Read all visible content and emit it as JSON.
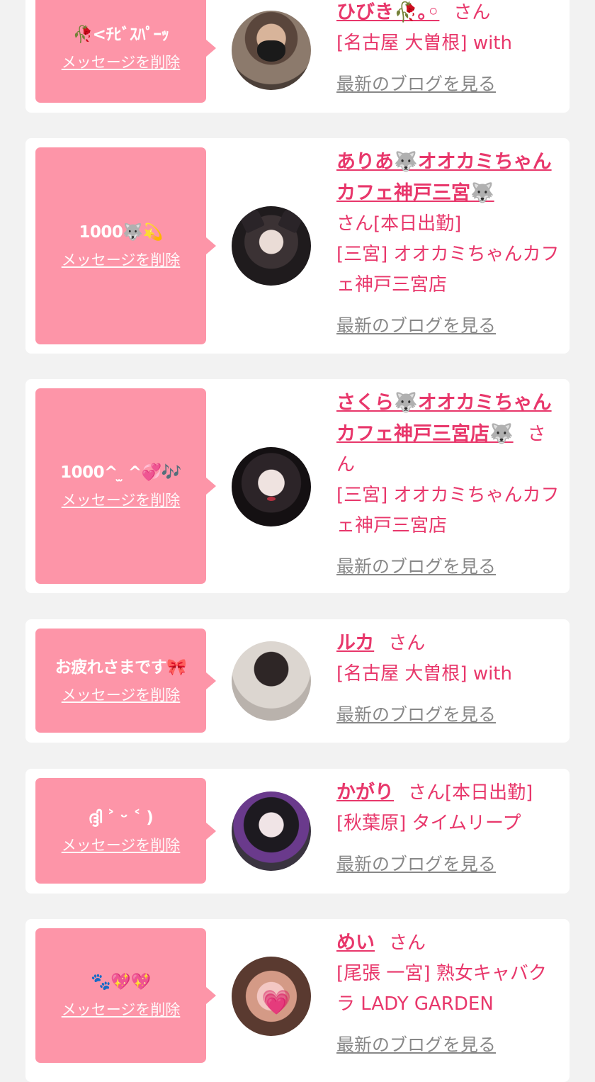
{
  "delete_label": "メッセージを削除",
  "blog_label": "最新のブログを見る",
  "san_label": "さん",
  "entries": [
    {
      "message": "🥀<ﾁﾋﾞｽﾊﾟｰｯ",
      "name": "ひびき🥀｡◦",
      "san": "さん",
      "status": "",
      "shop": "[名古屋 大曽根] with"
    },
    {
      "message": "1000🐺💫",
      "name": "ありあ🐺オオカミちゃんカフェ神戸三宮🐺",
      "san": "さん",
      "status": "[本日出勤]",
      "shop": "[三宮] オオカミちゃんカフェ神戸三宮店"
    },
    {
      "message": "1000^ ̫ ^💞🎶",
      "name": "さくら🐺オオカミちゃんカフェ神戸三宮店🐺",
      "san": "さん",
      "status": "",
      "shop": "[三宮] オオカミちゃんカフェ神戸三宮店"
    },
    {
      "message": "お疲れさまです🎀",
      "name": "ルカ",
      "san": "さん",
      "status": "",
      "shop": "[名古屋 大曽根] with"
    },
    {
      "message": "ദ്ദി ˃ ᵕ ˂ )",
      "name": "かがり",
      "san": "さん",
      "status": "[本日出勤]",
      "shop": "[秋葉原] タイムリープ"
    },
    {
      "message": "🐾💖💖",
      "name": "めい",
      "san": "さん",
      "status": "",
      "shop": "[尾張 一宮] 熟女キャバクラ LADY GARDEN"
    }
  ]
}
